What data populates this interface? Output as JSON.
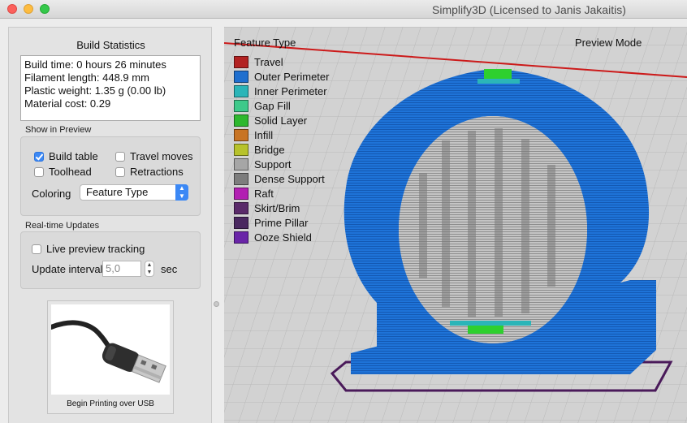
{
  "window": {
    "title": "Simplify3D (Licensed to Janis Jakaitis)"
  },
  "build_statistics": {
    "title": "Build Statistics",
    "lines": [
      "Build time: 0 hours 26 minutes",
      "Filament length: 448.9 mm",
      "Plastic weight: 1.35 g (0.00 lb)",
      "Material cost: 0.29"
    ]
  },
  "show_in_preview": {
    "label": "Show in Preview",
    "build_table": {
      "label": "Build table",
      "checked": true
    },
    "travel_moves": {
      "label": "Travel moves",
      "checked": false
    },
    "toolhead": {
      "label": "Toolhead",
      "checked": false
    },
    "retractions": {
      "label": "Retractions",
      "checked": false
    },
    "coloring_label": "Coloring",
    "coloring_value": "Feature Type"
  },
  "realtime_updates": {
    "label": "Real-time Updates",
    "live_preview": {
      "label": "Live preview tracking",
      "checked": false
    },
    "interval_label": "Update interval",
    "interval_value": "5,0",
    "interval_unit": "sec"
  },
  "usb": {
    "label": "Begin Printing over USB"
  },
  "viewport": {
    "legend_title": "Feature Type",
    "mode": "Preview Mode",
    "legend": [
      {
        "label": "Travel",
        "color": "#b22222"
      },
      {
        "label": "Outer Perimeter",
        "color": "#1f6fcf"
      },
      {
        "label": "Inner Perimeter",
        "color": "#2bb5b8"
      },
      {
        "label": "Gap Fill",
        "color": "#3ec98a"
      },
      {
        "label": "Solid Layer",
        "color": "#2eb82e"
      },
      {
        "label": "Infill",
        "color": "#c87424"
      },
      {
        "label": "Bridge",
        "color": "#b7c22b"
      },
      {
        "label": "Support",
        "color": "#a6a6a6"
      },
      {
        "label": "Dense Support",
        "color": "#7d7d7d"
      },
      {
        "label": "Raft",
        "color": "#b21fb2"
      },
      {
        "label": "Skirt/Brim",
        "color": "#5a2a6a"
      },
      {
        "label": "Prime Pillar",
        "color": "#4a2860"
      },
      {
        "label": "Ooze Shield",
        "color": "#6a25a8"
      }
    ]
  }
}
